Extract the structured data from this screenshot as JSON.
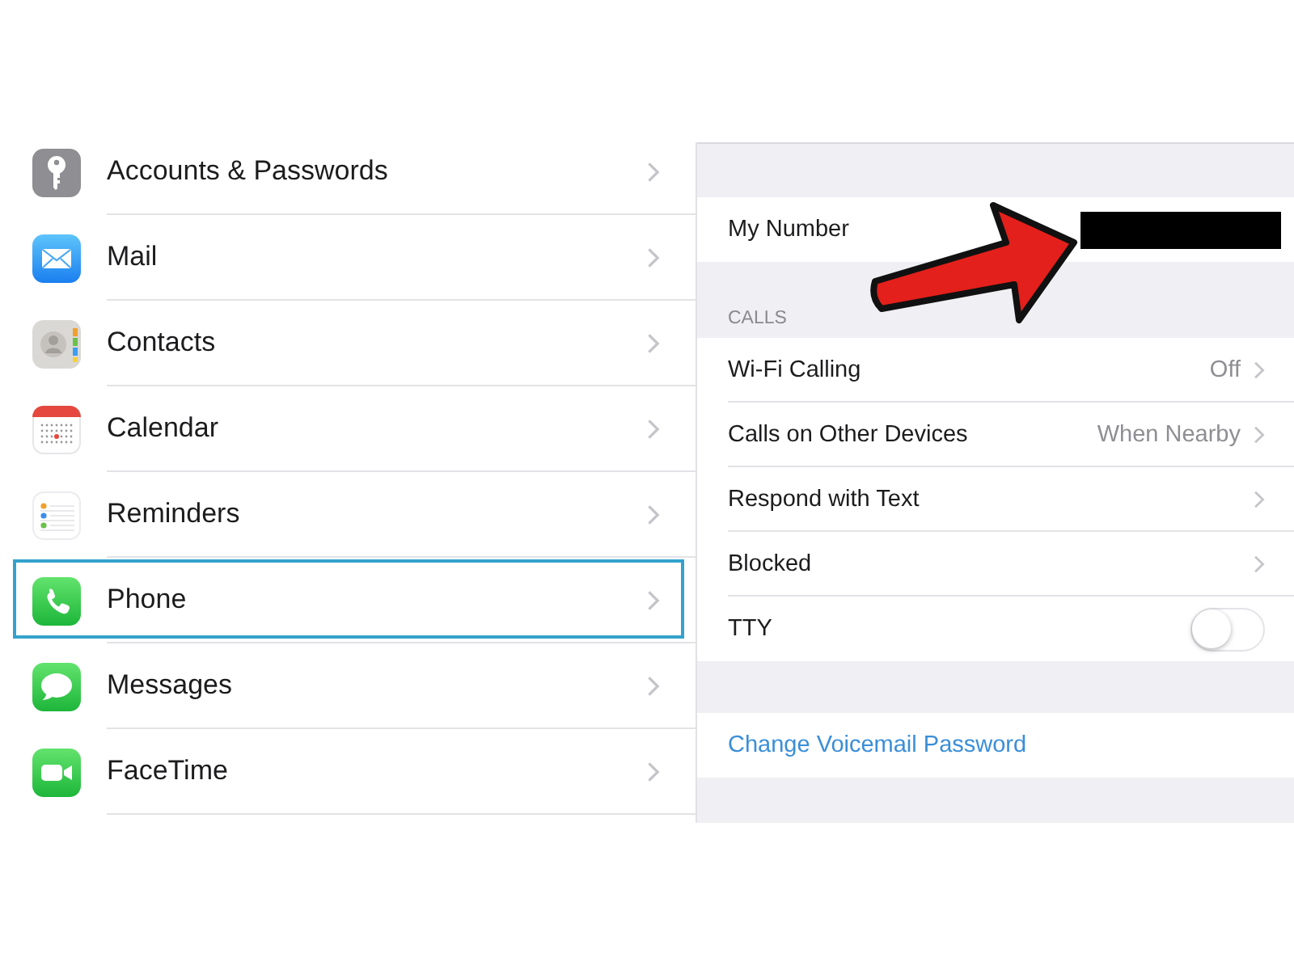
{
  "settings_list": [
    {
      "label": "Accounts & Passwords",
      "selected": false
    },
    {
      "label": "Mail",
      "selected": false
    },
    {
      "label": "Contacts",
      "selected": false
    },
    {
      "label": "Calendar",
      "selected": false
    },
    {
      "label": "Reminders",
      "selected": false
    },
    {
      "label": "Phone",
      "selected": true
    },
    {
      "label": "Messages",
      "selected": false
    },
    {
      "label": "FaceTime",
      "selected": false
    }
  ],
  "phone_settings": {
    "my_number": {
      "label": "My Number"
    },
    "calls": {
      "header": "CALLS",
      "rows": [
        {
          "kind": "chevron",
          "label": "Wi-Fi Calling",
          "value": "Off"
        },
        {
          "kind": "chevron",
          "label": "Calls on Other Devices",
          "value": "When Nearby"
        },
        {
          "kind": "chevron",
          "label": "Respond with Text"
        },
        {
          "kind": "chevron",
          "label": "Blocked"
        },
        {
          "kind": "toggle",
          "label": "TTY",
          "on": false
        }
      ]
    },
    "voicemail": {
      "label": "Change Voicemail Password"
    }
  }
}
